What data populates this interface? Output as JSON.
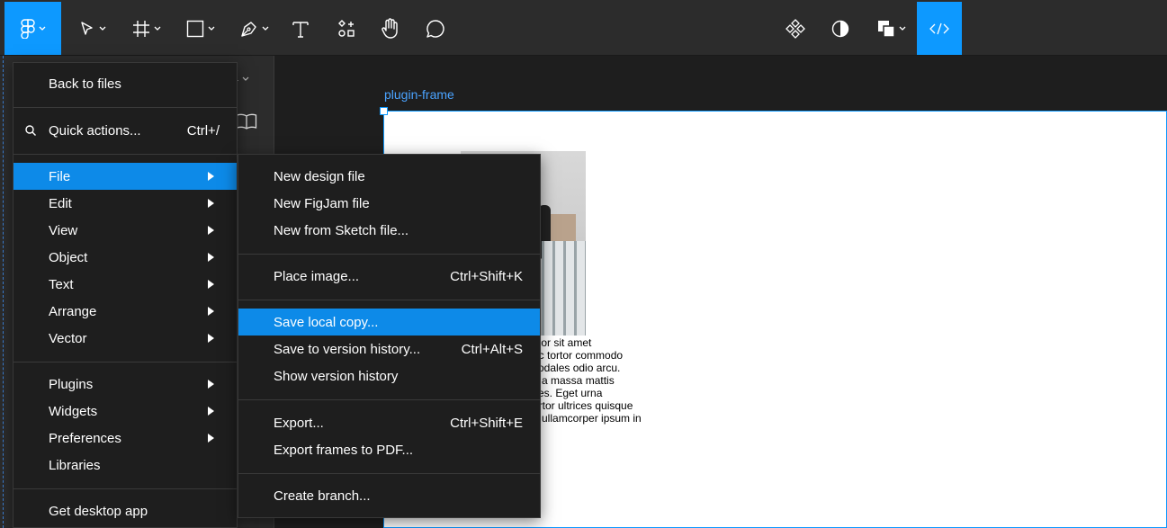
{
  "toolbar": {
    "tools": [
      "figma-menu",
      "move",
      "frame",
      "shape",
      "pen",
      "text",
      "resources",
      "hand",
      "comment"
    ],
    "right": [
      "components",
      "contrast",
      "fill",
      "dev-mode"
    ]
  },
  "left_panel": {
    "page_select": "1"
  },
  "canvas": {
    "frame_label": "plugin-frame",
    "lorem_lines": [
      "olor sit amet",
      "ac tortor commodo",
      "sodales odio arcu.",
      "n a massa mattis",
      "ces. Eget urna",
      "ortor ultrices quisque",
      "n ullamcorper ipsum in"
    ]
  },
  "main_menu": {
    "back": "Back to files",
    "quick_actions": "Quick actions...",
    "quick_actions_shortcut": "Ctrl+/",
    "file": "File",
    "edit": "Edit",
    "view": "View",
    "object": "Object",
    "text": "Text",
    "arrange": "Arrange",
    "vector": "Vector",
    "plugins": "Plugins",
    "widgets": "Widgets",
    "preferences": "Preferences",
    "libraries": "Libraries",
    "desktop": "Get desktop app"
  },
  "file_menu": {
    "new_design": "New design file",
    "new_figjam": "New FigJam file",
    "new_sketch": "New from Sketch file...",
    "place_image": "Place image...",
    "place_image_sc": "Ctrl+Shift+K",
    "save_local": "Save local copy...",
    "save_version": "Save to version history...",
    "save_version_sc": "Ctrl+Alt+S",
    "show_version": "Show version history",
    "export": "Export...",
    "export_sc": "Ctrl+Shift+E",
    "export_pdf": "Export frames to PDF...",
    "create_branch": "Create branch..."
  },
  "colors": {
    "accent": "#0d99ff",
    "highlight": "#0d8ae8",
    "menu_bg": "#1e1e1e"
  }
}
